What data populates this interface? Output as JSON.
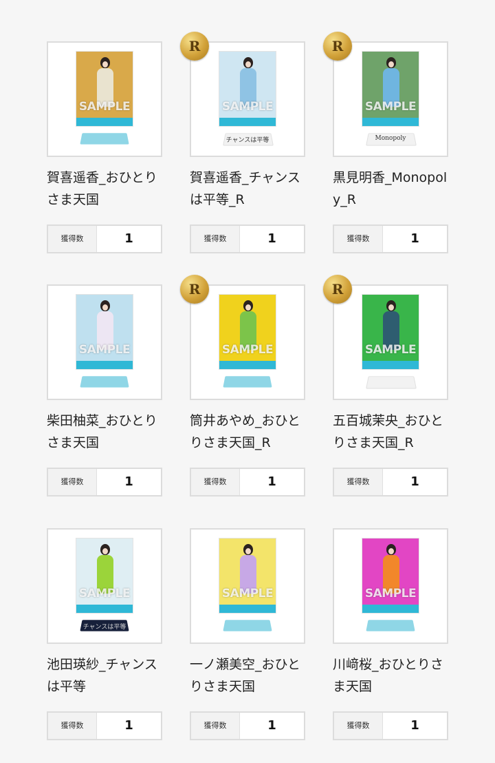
{
  "count_label": "獲得数",
  "items": [
    {
      "title": "賀喜遥香_おひとりさま天国",
      "count": "1",
      "rare": false,
      "rare_mark": "",
      "base_text": "",
      "colors": {
        "bg": "#d9a94a",
        "outfit": "#e9e3cf",
        "base": "normal"
      }
    },
    {
      "title": "賀喜遥香_チャンスは平等_R",
      "count": "1",
      "rare": true,
      "rare_mark": "R",
      "base_text": "チャンスは平等",
      "colors": {
        "bg": "#cfe6f2",
        "outfit": "#8fc3e4",
        "base": "plain"
      }
    },
    {
      "title": "黒見明香_Monopoly_R",
      "count": "1",
      "rare": true,
      "rare_mark": "R",
      "base_text": "Monopoly",
      "colors": {
        "bg": "#6fa36a",
        "outfit": "#6fb5e0",
        "base": "plain"
      }
    },
    {
      "title": "柴田柚菜_おひとりさま天国",
      "count": "1",
      "rare": false,
      "rare_mark": "",
      "base_text": "",
      "colors": {
        "bg": "#bfe0ef",
        "outfit": "#ede6f3",
        "base": "normal"
      }
    },
    {
      "title": "筒井あやめ_おひとりさま天国_R",
      "count": "1",
      "rare": true,
      "rare_mark": "R",
      "base_text": "",
      "colors": {
        "bg": "#f0d21d",
        "outfit": "#7cc44a",
        "base": "normal"
      }
    },
    {
      "title": "五百城茉央_おひとりさま天国_R",
      "count": "1",
      "rare": true,
      "rare_mark": "R",
      "base_text": "",
      "colors": {
        "bg": "#39b54a",
        "outfit": "#2e5d70",
        "base": "plain"
      }
    },
    {
      "title": "池田瑛紗_チャンスは平等",
      "count": "1",
      "rare": false,
      "rare_mark": "",
      "base_text": "チャンスは平等",
      "colors": {
        "bg": "#dfeef3",
        "outfit": "#9bd43a",
        "base": "dark"
      }
    },
    {
      "title": "一ノ瀬美空_おひとりさま天国",
      "count": "1",
      "rare": false,
      "rare_mark": "",
      "base_text": "",
      "colors": {
        "bg": "#f3e46a",
        "outfit": "#c7a8e6",
        "base": "normal"
      }
    },
    {
      "title": "川﨑桜_おひとりさま天国",
      "count": "1",
      "rare": false,
      "rare_mark": "",
      "base_text": "",
      "colors": {
        "bg": "#e246c4",
        "outfit": "#f2872a",
        "base": "normal"
      }
    }
  ]
}
